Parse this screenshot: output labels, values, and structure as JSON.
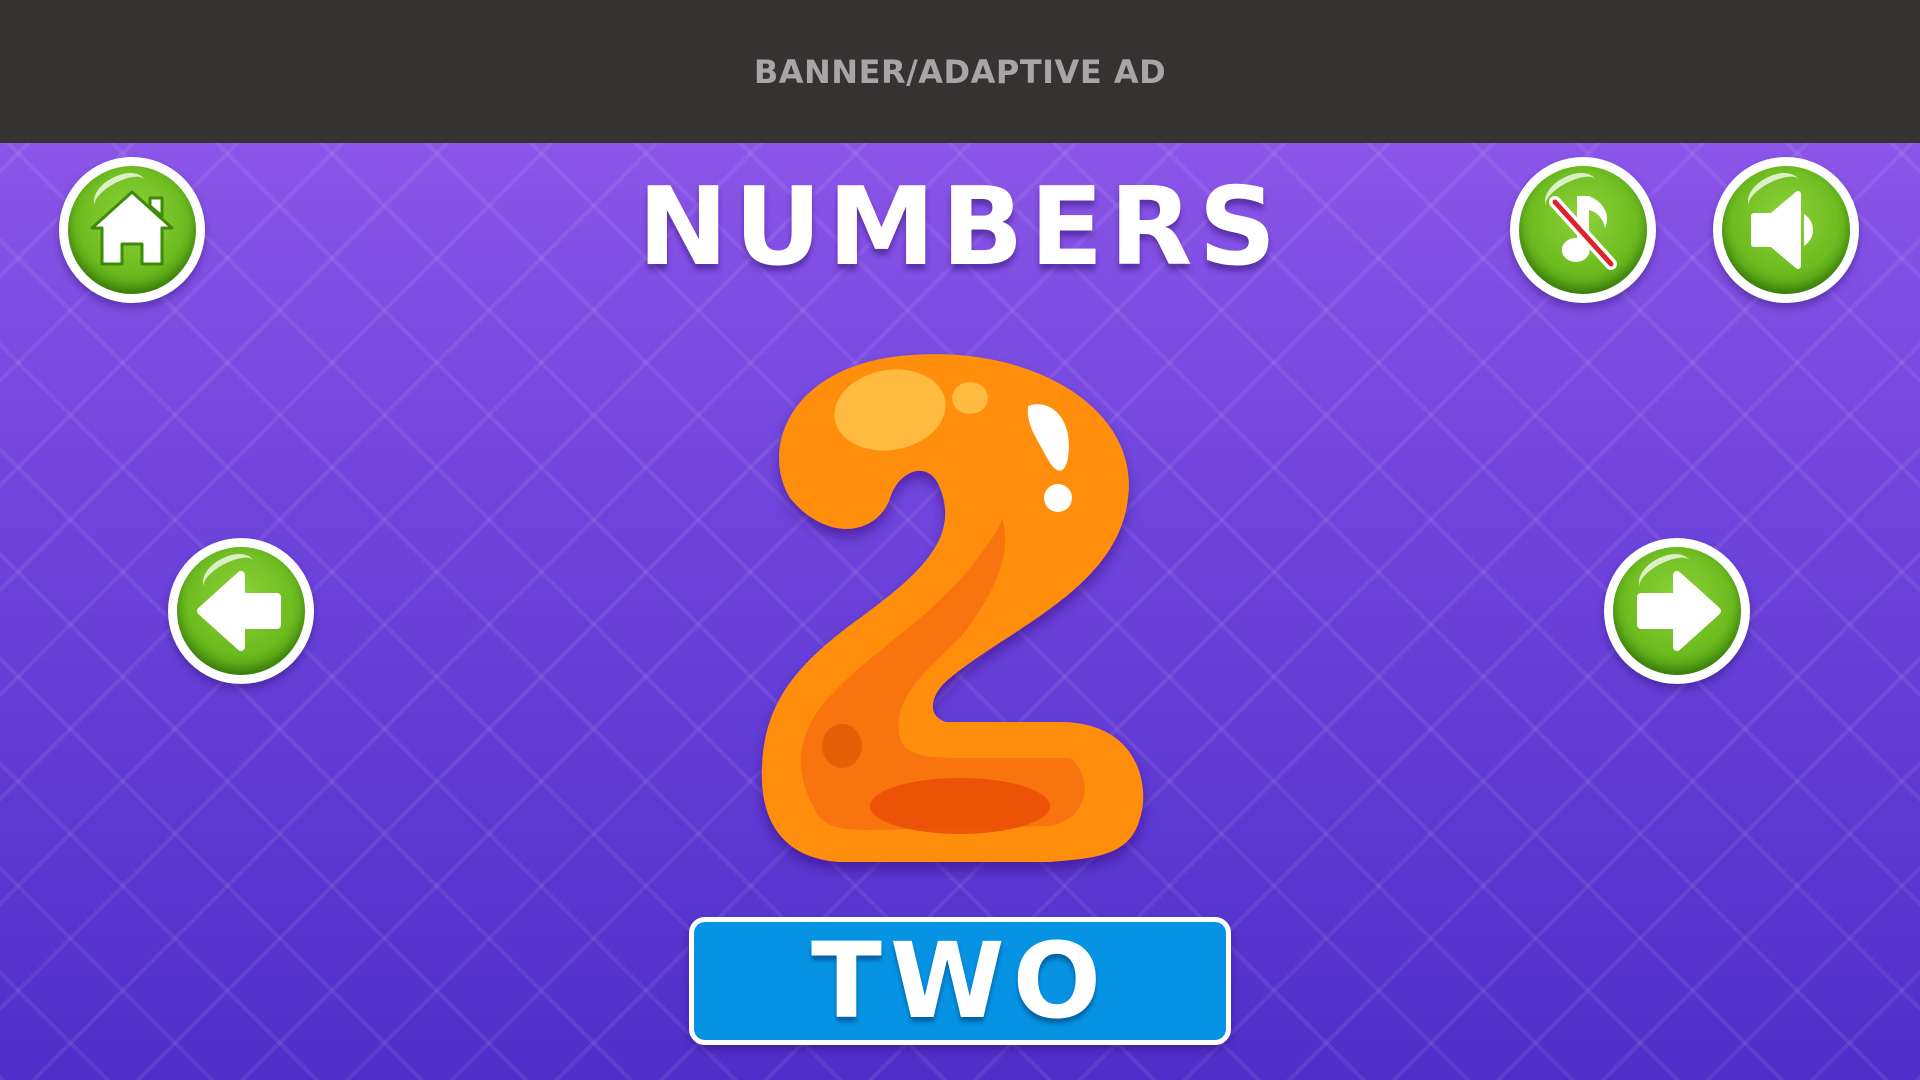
{
  "ad_banner": {
    "label": "BANNER/ADAPTIVE AD"
  },
  "header": {
    "title": "NUMBERS"
  },
  "buttons": {
    "home": {
      "icon": "home-icon"
    },
    "music": {
      "icon": "music-muted-icon",
      "state": "muted"
    },
    "sound": {
      "icon": "speaker-icon",
      "state": "on"
    },
    "previous": {
      "icon": "arrow-left-icon"
    },
    "next": {
      "icon": "arrow-right-icon"
    }
  },
  "card": {
    "number": "2",
    "word": "TWO"
  },
  "colors": {
    "banner_bg": "#353232",
    "game_bg": "#6a3fd9",
    "button_green": "#6cbb1f",
    "number_orange": "#ff8c00",
    "word_box_blue": "#0693e4"
  }
}
